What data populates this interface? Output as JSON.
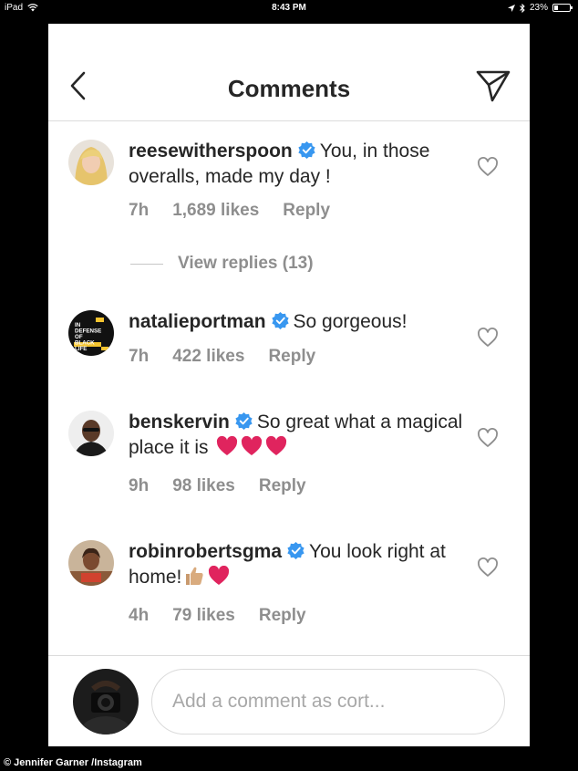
{
  "status_bar": {
    "device": "iPad",
    "time": "8:43 PM",
    "battery": "23%",
    "battery_level": 0.23
  },
  "header": {
    "title": "Comments",
    "back_icon": "chevron-left-icon",
    "send_icon": "paper-plane-icon"
  },
  "comments": [
    {
      "username": "reesewitherspoon",
      "verified": true,
      "text": "You, in those overalls, made my day !",
      "time": "7h",
      "likes": "1,689 likes",
      "reply_label": "Reply"
    },
    {
      "username": "natalieportman",
      "verified": true,
      "text": "So gorgeous!",
      "time": "7h",
      "likes": "422 likes",
      "reply_label": "Reply",
      "avatar_text": "IN DEFENSE OF BLACK LIFE"
    },
    {
      "username": "benskervin",
      "verified": true,
      "text": "So great what a magical place it is",
      "emojis": [
        "red-heart-icon",
        "red-heart-icon",
        "red-heart-icon"
      ],
      "time": "9h",
      "likes": "98 likes",
      "reply_label": "Reply"
    },
    {
      "username": "robinrobertsgma",
      "verified": true,
      "text": "You look right at home!",
      "emojis": [
        "thumbs-up-icon",
        "red-heart-icon"
      ],
      "time": "4h",
      "likes": "79 likes",
      "reply_label": "Reply"
    }
  ],
  "view_replies": "View replies (13)",
  "composer": {
    "placeholder": "Add a comment as cort..."
  },
  "credit": "© Jennifer Garner /Instagram",
  "colors": {
    "verified_blue": "#3897f0",
    "muted_text": "#8e8e8e",
    "emoji_heart": "#e0245e"
  }
}
